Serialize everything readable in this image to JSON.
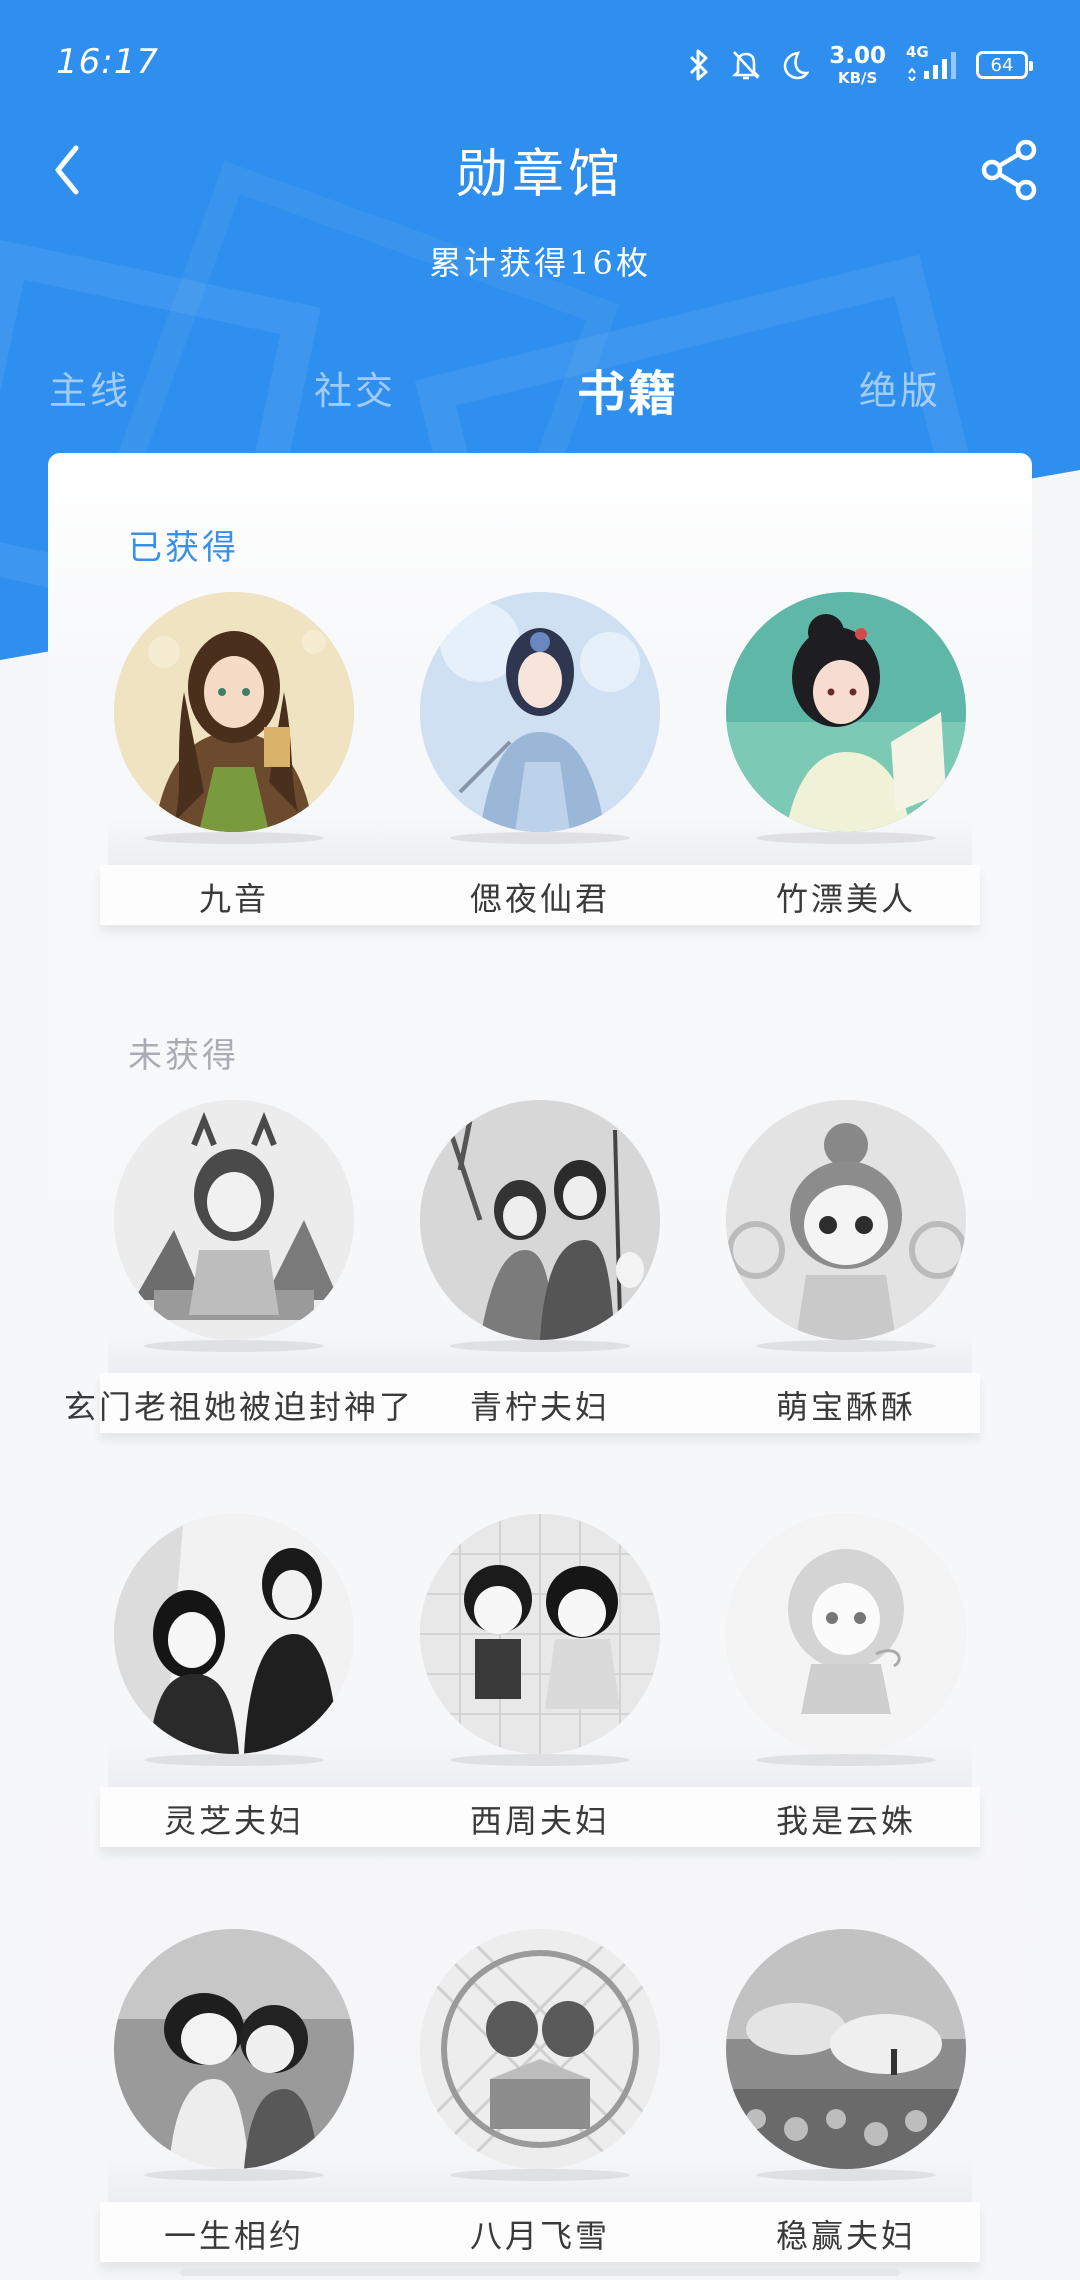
{
  "status_bar": {
    "time": "16:17",
    "net_speed_value": "3.00",
    "net_speed_unit": "KB/S",
    "network_type": "4G",
    "battery_level": "64",
    "icons": [
      "bluetooth-icon",
      "mute-bell-icon",
      "moon-icon",
      "signal-icon",
      "battery-icon"
    ]
  },
  "header": {
    "title": "勋章馆",
    "subtitle": "累计获得16枚",
    "back_icon": "chevron-left-icon",
    "share_icon": "share-icon"
  },
  "tabs": [
    {
      "label": "主线",
      "active": false
    },
    {
      "label": "社交",
      "active": false
    },
    {
      "label": "书籍",
      "active": true
    },
    {
      "label": "绝版",
      "active": false
    }
  ],
  "sections": {
    "earned": {
      "label": "已获得",
      "badges": [
        "九音",
        "偲夜仙君",
        "竹漂美人"
      ]
    },
    "unearned": {
      "label": "未获得",
      "badges": [
        "玄门老祖她被迫封神了",
        "青柠夫妇",
        "萌宝酥酥",
        "灵芝夫妇",
        "西周夫妇",
        "我是云姝",
        "一生相约",
        "八月飞雪",
        "稳赢夫妇"
      ]
    }
  },
  "colors": {
    "header_blue": "#2f8fee",
    "earned_label": "#3a8fe8",
    "unearned_label": "#a9adb3"
  }
}
